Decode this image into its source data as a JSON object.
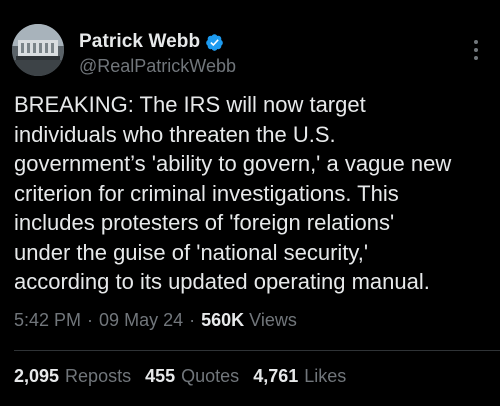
{
  "author": {
    "display_name": "Patrick Webb",
    "handle": "@RealPatrickWebb",
    "verified": true
  },
  "tweet": {
    "text": "BREAKING: The IRS will now target\nindividuals who threaten the U.S.\ngovernment’s 'ability to govern,' a vague new\ncriterion for criminal investigations. This\nincludes protesters of 'foreign relations'\nunder the guise of 'national security,'\naccording to its updated operating manual."
  },
  "meta": {
    "time": "5:42 PM",
    "separator": "·",
    "date": "09 May 24",
    "views_count": "560K",
    "views_label": "Views"
  },
  "stats": {
    "reposts_count": "2,095",
    "reposts_label": "Reposts",
    "quotes_count": "455",
    "quotes_label": "Quotes",
    "likes_count": "4,761",
    "likes_label": "Likes"
  },
  "colors": {
    "background": "#000000",
    "text_primary": "#e7e9ea",
    "text_secondary": "#71767b",
    "verified_badge": "#1d9bf0",
    "divider": "#2f3336"
  },
  "icons": {
    "verified": "verified-badge-icon",
    "more": "more-options-icon"
  }
}
